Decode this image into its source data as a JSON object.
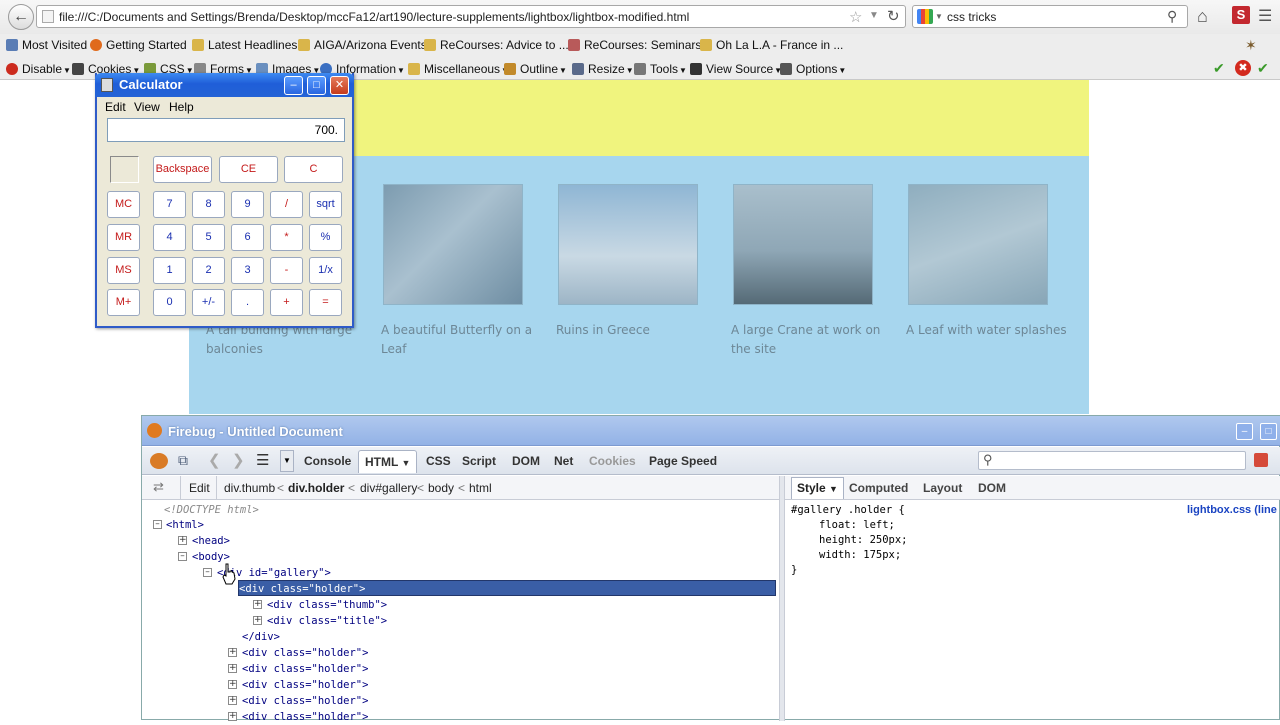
{
  "browser": {
    "url": "file:///C:/Documents and Settings/Brenda/Desktop/mccFa12/art190/lecture-supplements/lightbox/lightbox-modified.html",
    "search_value": "css tricks",
    "bookmarks": [
      "Most Visited",
      "Getting Started",
      "Latest Headlines",
      "AIGA/Arizona Events",
      "ReCourses: Advice to ...",
      "ReCourses: Seminars",
      "Oh La L.A - France in ..."
    ],
    "webdev_toolbar": [
      "Disable",
      "Cookies",
      "CSS",
      "Forms",
      "Images",
      "Information",
      "Miscellaneous",
      "Outline",
      "Resize",
      "Tools",
      "View Source",
      "Options"
    ]
  },
  "page": {
    "captions": [
      "A tall building with large balconies",
      "A beautiful Butterfly on a Leaf",
      "Ruins in Greece",
      "A large Crane at work on the site",
      "A Leaf with water splashes"
    ],
    "colors": {
      "header": "#f0f47e",
      "gallery": "#a7d6ee"
    }
  },
  "calculator": {
    "title": "Calculator",
    "menu": [
      "Edit",
      "View",
      "Help"
    ],
    "display": "700.",
    "top_buttons": [
      "Backspace",
      "CE",
      "C"
    ],
    "rows": [
      [
        "MC",
        "7",
        "8",
        "9",
        "/",
        "sqrt"
      ],
      [
        "MR",
        "4",
        "5",
        "6",
        "*",
        "%"
      ],
      [
        "MS",
        "1",
        "2",
        "3",
        "-",
        "1/x"
      ],
      [
        "M+",
        "0",
        "+/-",
        ".",
        "+",
        "="
      ]
    ]
  },
  "firebug": {
    "title": "Firebug - Untitled Document",
    "tabs": [
      "Console",
      "HTML",
      "CSS",
      "Script",
      "DOM",
      "Net",
      "Cookies",
      "Page Speed"
    ],
    "active_tab": "HTML",
    "edit_label": "Edit",
    "breadcrumbs": [
      "div.thumb",
      "div.holder",
      "div#gallery",
      "body",
      "html"
    ],
    "side_tabs": [
      "Style",
      "Computed",
      "Layout",
      "DOM"
    ],
    "css_source": "lightbox.css (line",
    "tree": {
      "doctype": "<!DOCTYPE html>",
      "html": "<html>",
      "head": "<head>",
      "body": "<body>",
      "gallery": "<div id=\"gallery\">",
      "holder_selected": "<div class=\"holder\">",
      "thumb": "<div class=\"thumb\">",
      "title": "<div class=\"title\">",
      "close_div": "</div>",
      "holders": [
        "<div class=\"holder\">",
        "<div class=\"holder\">",
        "<div class=\"holder\">",
        "<div class=\"holder\">",
        "<div class=\"holder\">"
      ]
    },
    "css_rule": {
      "selector": "#gallery .holder {",
      "declarations": [
        "float: left;",
        "height: 250px;",
        "width: 175px;"
      ],
      "close": "}"
    }
  }
}
